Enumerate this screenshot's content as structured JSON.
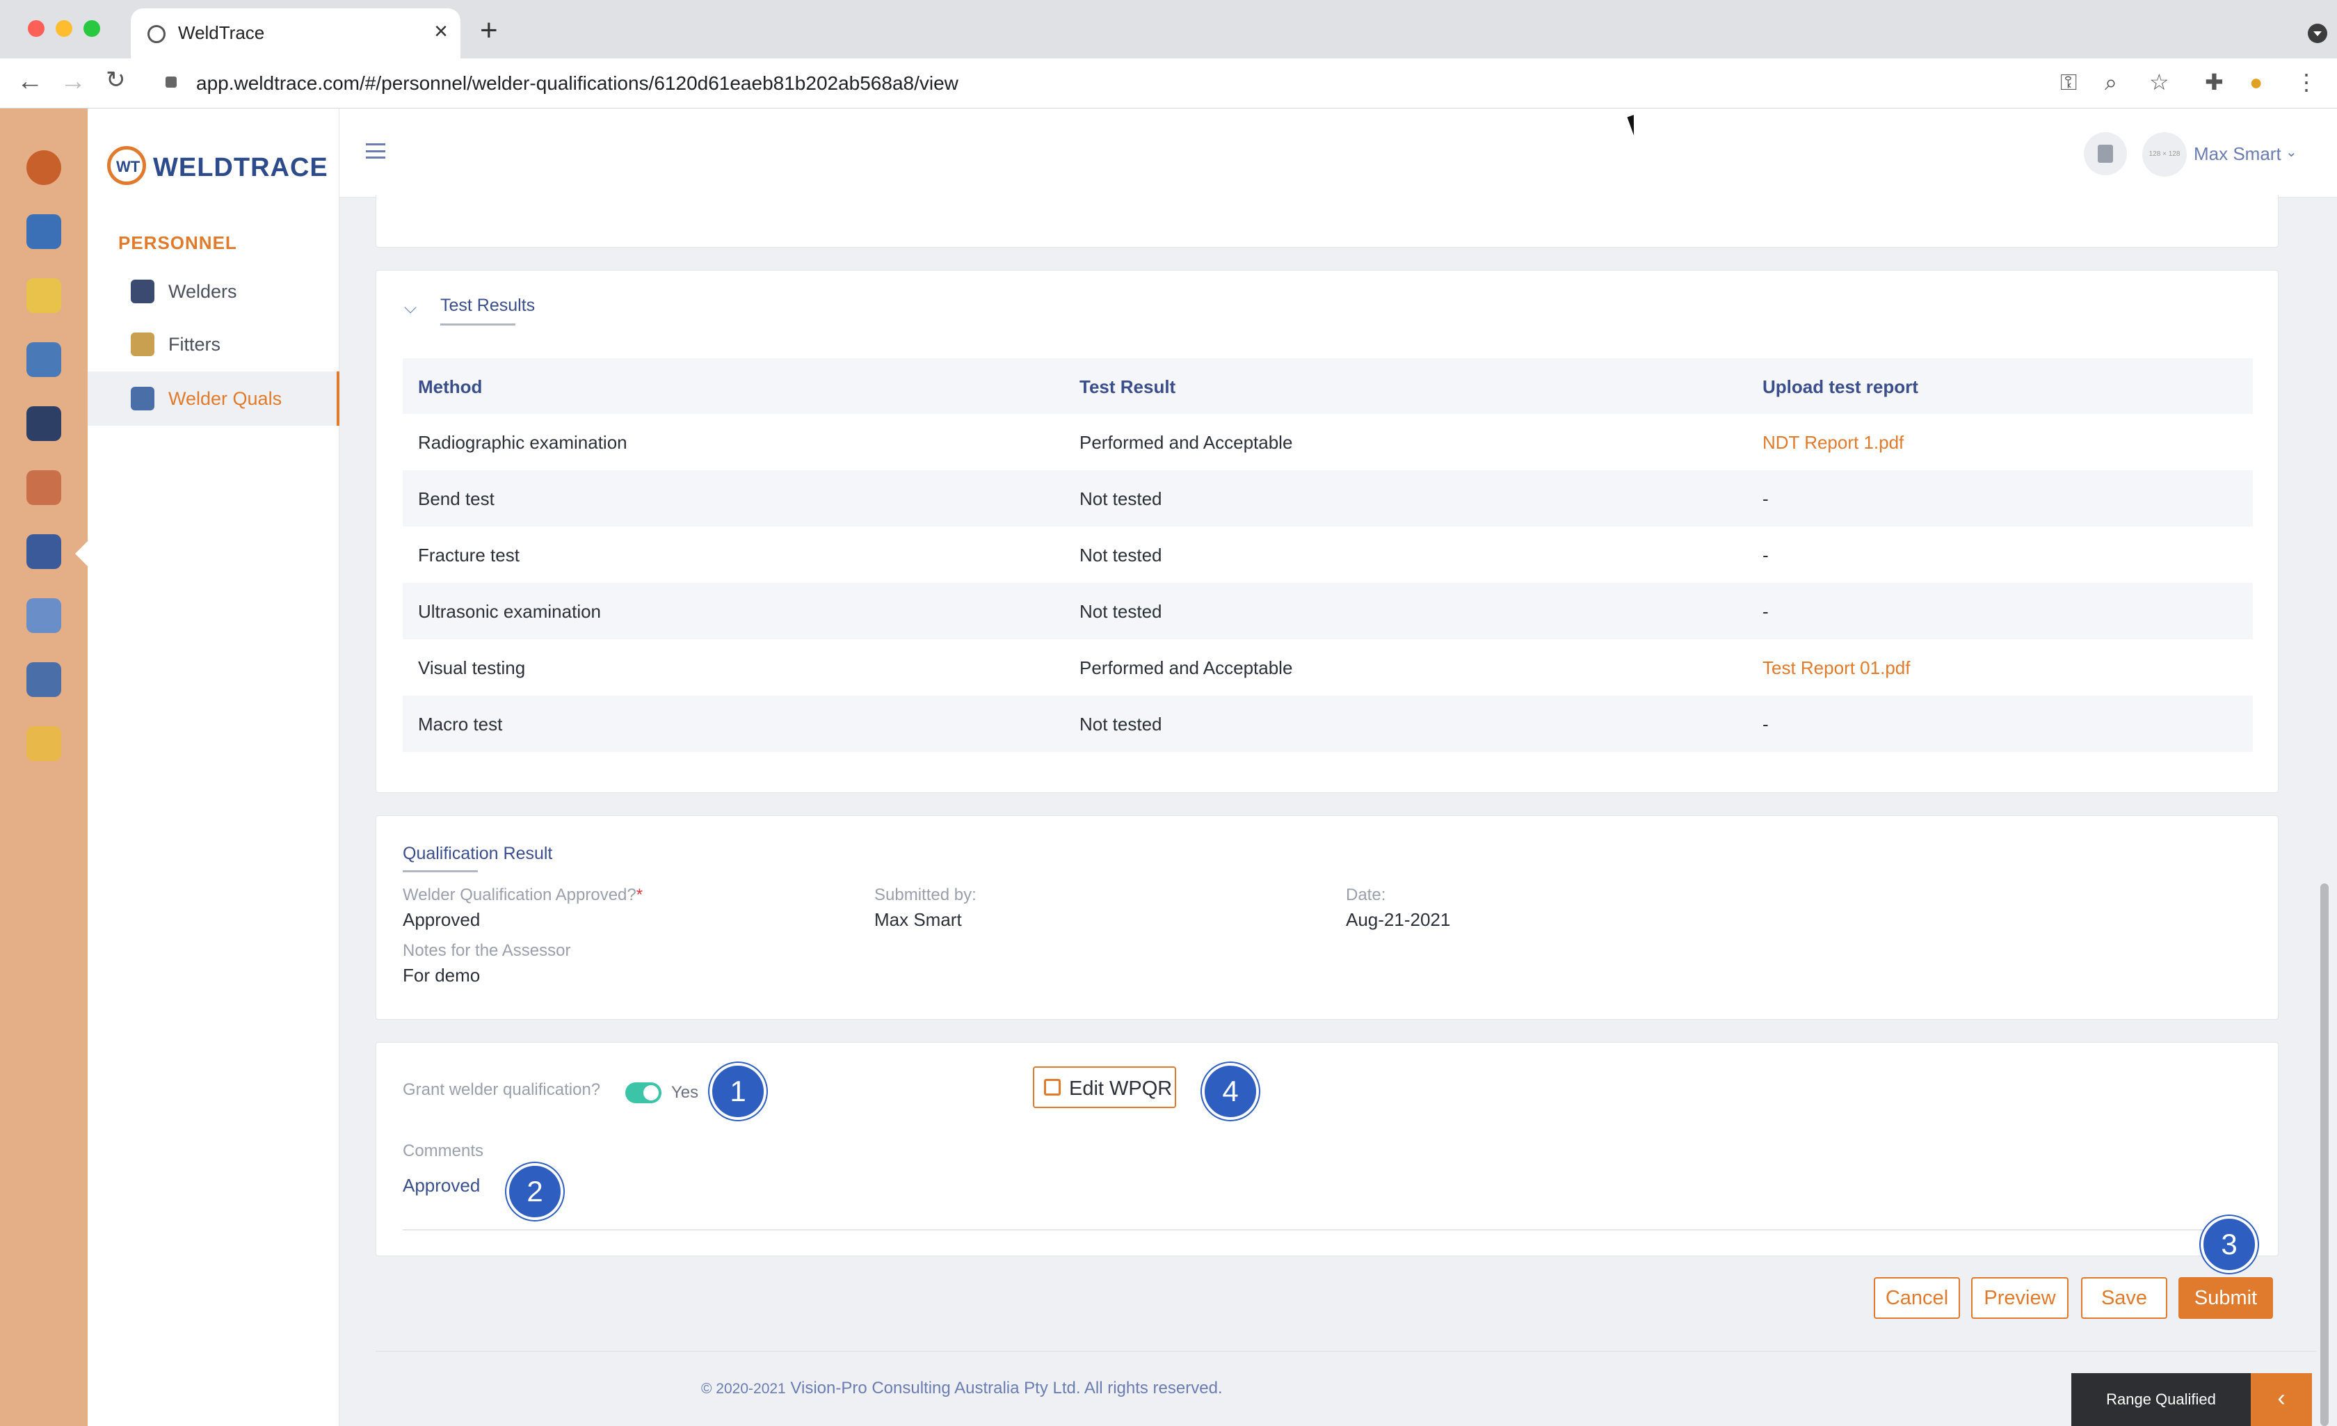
{
  "browser": {
    "tab_title": "WeldTrace",
    "url": "app.weldtrace.com/#/personnel/welder-qualifications/6120d61eaeb81b202ab568a8/view"
  },
  "brand": {
    "logo_text": "WELDTRACE",
    "accent": "#e07a2c",
    "rail_color": "#e4ae86"
  },
  "sidebar": {
    "section": "PERSONNEL",
    "items": [
      {
        "label": "Welders"
      },
      {
        "label": "Fitters"
      },
      {
        "label": "Welder Quals"
      }
    ]
  },
  "header": {
    "user_name": "Max Smart",
    "avatar_placeholder": "128 × 128"
  },
  "test_results": {
    "title": "Test Results",
    "columns": [
      "Method",
      "Test Result",
      "Upload test report"
    ],
    "rows": [
      {
        "method": "Radiographic examination",
        "result": "Performed and Acceptable",
        "report": "NDT Report 1.pdf"
      },
      {
        "method": "Bend test",
        "result": "Not tested",
        "report": "-"
      },
      {
        "method": "Fracture test",
        "result": "Not tested",
        "report": "-"
      },
      {
        "method": "Ultrasonic examination",
        "result": "Not tested",
        "report": "-"
      },
      {
        "method": "Visual testing",
        "result": "Performed and Acceptable",
        "report": "Test Report 01.pdf"
      },
      {
        "method": "Macro test",
        "result": "Not tested",
        "report": "-"
      }
    ]
  },
  "qualification_result": {
    "title": "Qualification Result",
    "approved_label": "Welder Qualification Approved?",
    "required_mark": "*",
    "approved_value": "Approved",
    "submitted_by_label": "Submitted by:",
    "submitted_by_value": "Max Smart",
    "date_label": "Date:",
    "date_value": "Aug-21-2021",
    "notes_label": "Notes for the Assessor",
    "notes_value": "For demo"
  },
  "grant": {
    "question": "Grant welder qualification?",
    "toggle_on": true,
    "toggle_label": "Yes",
    "edit_button": "Edit WPQR",
    "comments_label": "Comments",
    "comments_value": "Approved"
  },
  "callouts": [
    "1",
    "2",
    "3",
    "4"
  ],
  "actions": {
    "cancel": "Cancel",
    "preview": "Preview",
    "save": "Save",
    "submit": "Submit"
  },
  "footer": {
    "years": "© 2020-2021",
    "text": "Vision-Pro Consulting Australia Pty Ltd. All rights reserved."
  },
  "range_panel": {
    "label": "Range Qualified",
    "toggle_icon": "chevron-left-icon"
  }
}
